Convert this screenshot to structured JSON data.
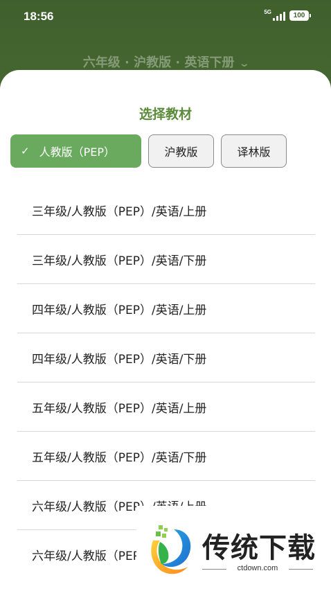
{
  "status": {
    "time": "18:56",
    "network": "5G",
    "battery": "100"
  },
  "header": {
    "title": "六年级 · 沪教版 · 英语下册"
  },
  "sheet": {
    "title": "选择教材",
    "chips": [
      {
        "label": "人教版（PEP）",
        "selected": true
      },
      {
        "label": "沪教版",
        "selected": false
      },
      {
        "label": "译林版",
        "selected": false
      }
    ],
    "items": [
      "三年级/人教版（PEP）/英语/上册",
      "三年级/人教版（PEP）/英语/下册",
      "四年级/人教版（PEP）/英语/上册",
      "四年级/人教版（PEP）/英语/下册",
      "五年级/人教版（PEP）/英语/上册",
      "五年级/人教版（PEP）/英语/下册",
      "六年级/人教版（PEP）/英语/上册",
      "六年级/人教版（PEP）/英语/下册"
    ]
  },
  "watermark": {
    "name": "传统下载",
    "url": "ctdown.com"
  },
  "colors": {
    "accent": "#6aaa5e",
    "title_green": "#5a8a3a",
    "header_bg": "#3f5f2c"
  }
}
